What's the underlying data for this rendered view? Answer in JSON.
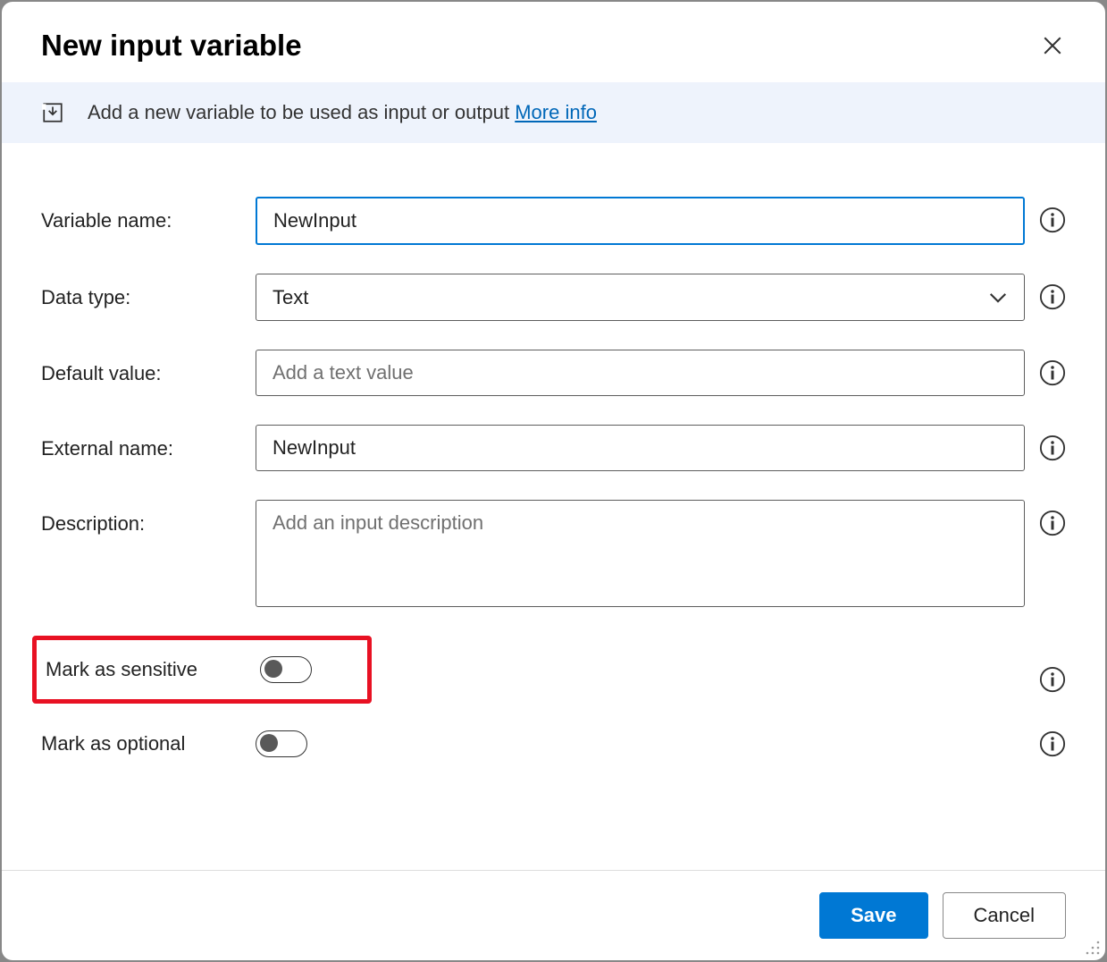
{
  "header": {
    "title": "New input variable"
  },
  "banner": {
    "text": "Add a new variable to be used as input or output ",
    "link": "More info"
  },
  "form": {
    "variable_name": {
      "label": "Variable name:",
      "value": "NewInput"
    },
    "data_type": {
      "label": "Data type:",
      "value": "Text"
    },
    "default_value": {
      "label": "Default value:",
      "value": "",
      "placeholder": "Add a text value"
    },
    "external_name": {
      "label": "External name:",
      "value": "NewInput"
    },
    "description": {
      "label": "Description:",
      "value": "",
      "placeholder": "Add an input description"
    },
    "mark_sensitive": {
      "label": "Mark as sensitive",
      "on": false
    },
    "mark_optional": {
      "label": "Mark as optional",
      "on": false
    }
  },
  "footer": {
    "save": "Save",
    "cancel": "Cancel"
  }
}
